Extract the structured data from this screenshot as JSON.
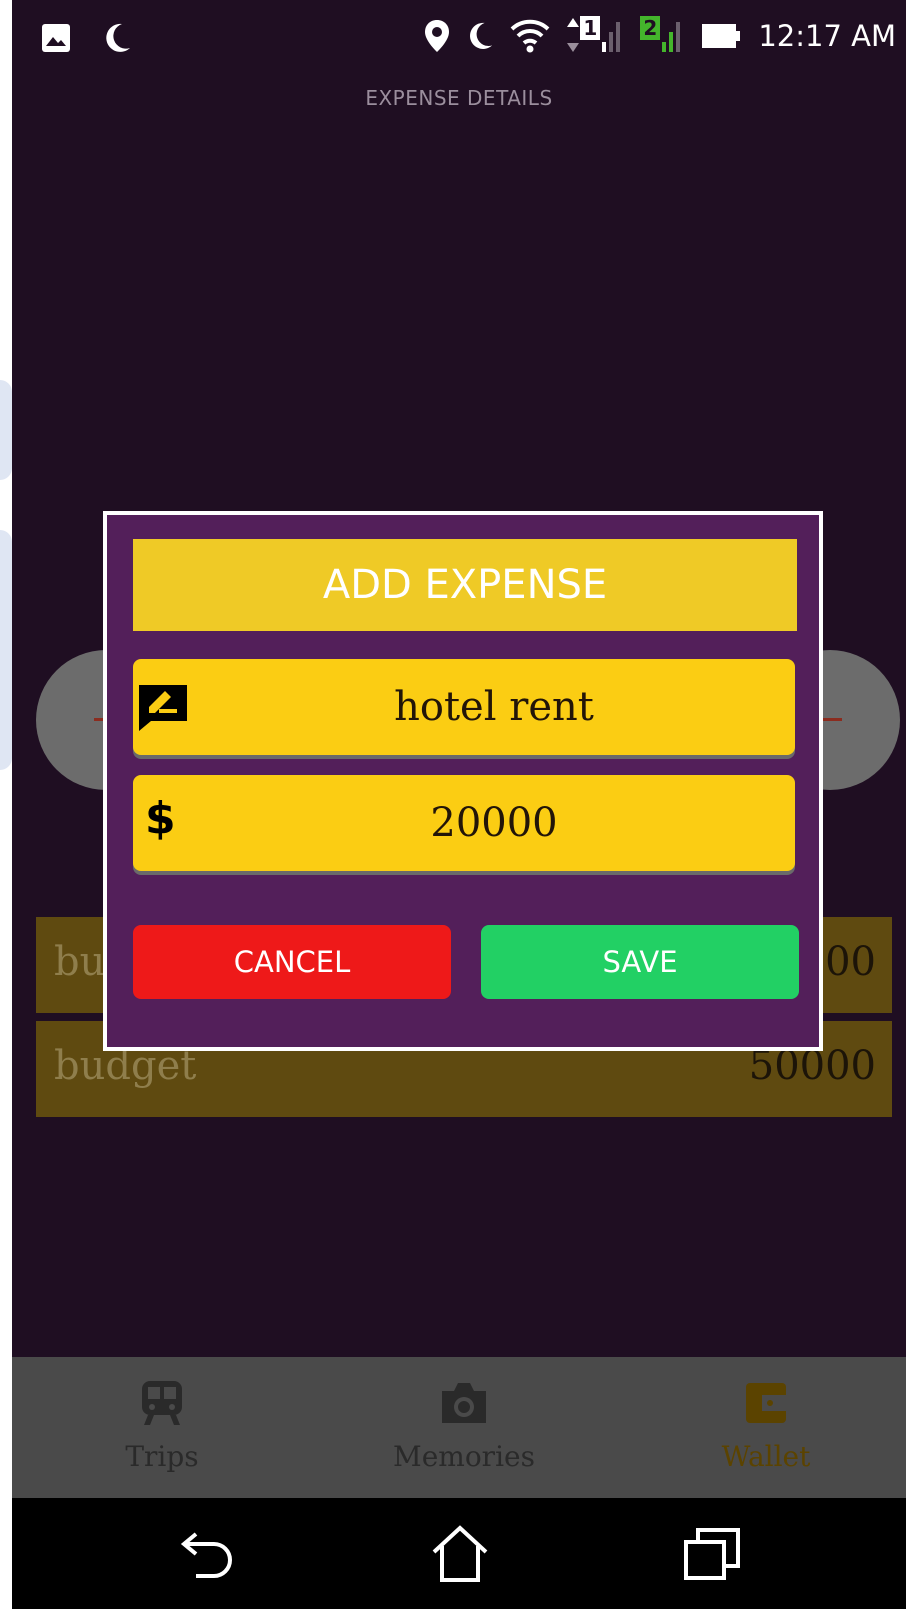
{
  "status_bar": {
    "time": "12:17 AM",
    "sim1": "1",
    "sim2": "2"
  },
  "header": {
    "title": "EXPENSE DETAILS"
  },
  "background_rows": [
    {
      "label": "bu",
      "value": "00"
    },
    {
      "label": "budget",
      "value": "50000"
    }
  ],
  "dialog": {
    "title": "ADD EXPENSE",
    "name_field": {
      "value": "hotel rent",
      "icon": "edit-note-icon"
    },
    "amount_field": {
      "value": "20000",
      "icon": "dollar-icon",
      "symbol": "$"
    },
    "cancel_label": "CANCEL",
    "save_label": "SAVE"
  },
  "bottom_nav": {
    "items": [
      {
        "label": "Trips",
        "icon": "train-icon"
      },
      {
        "label": "Memories",
        "icon": "camera-icon"
      },
      {
        "label": "Wallet",
        "icon": "wallet-icon",
        "active": true
      }
    ]
  },
  "colors": {
    "background": "#1f0e22",
    "dialog_bg": "#531f5a",
    "dialog_title_bg": "#efca26",
    "field_bg": "#fbcd13",
    "cancel": "#ee1919",
    "save": "#22d064"
  }
}
